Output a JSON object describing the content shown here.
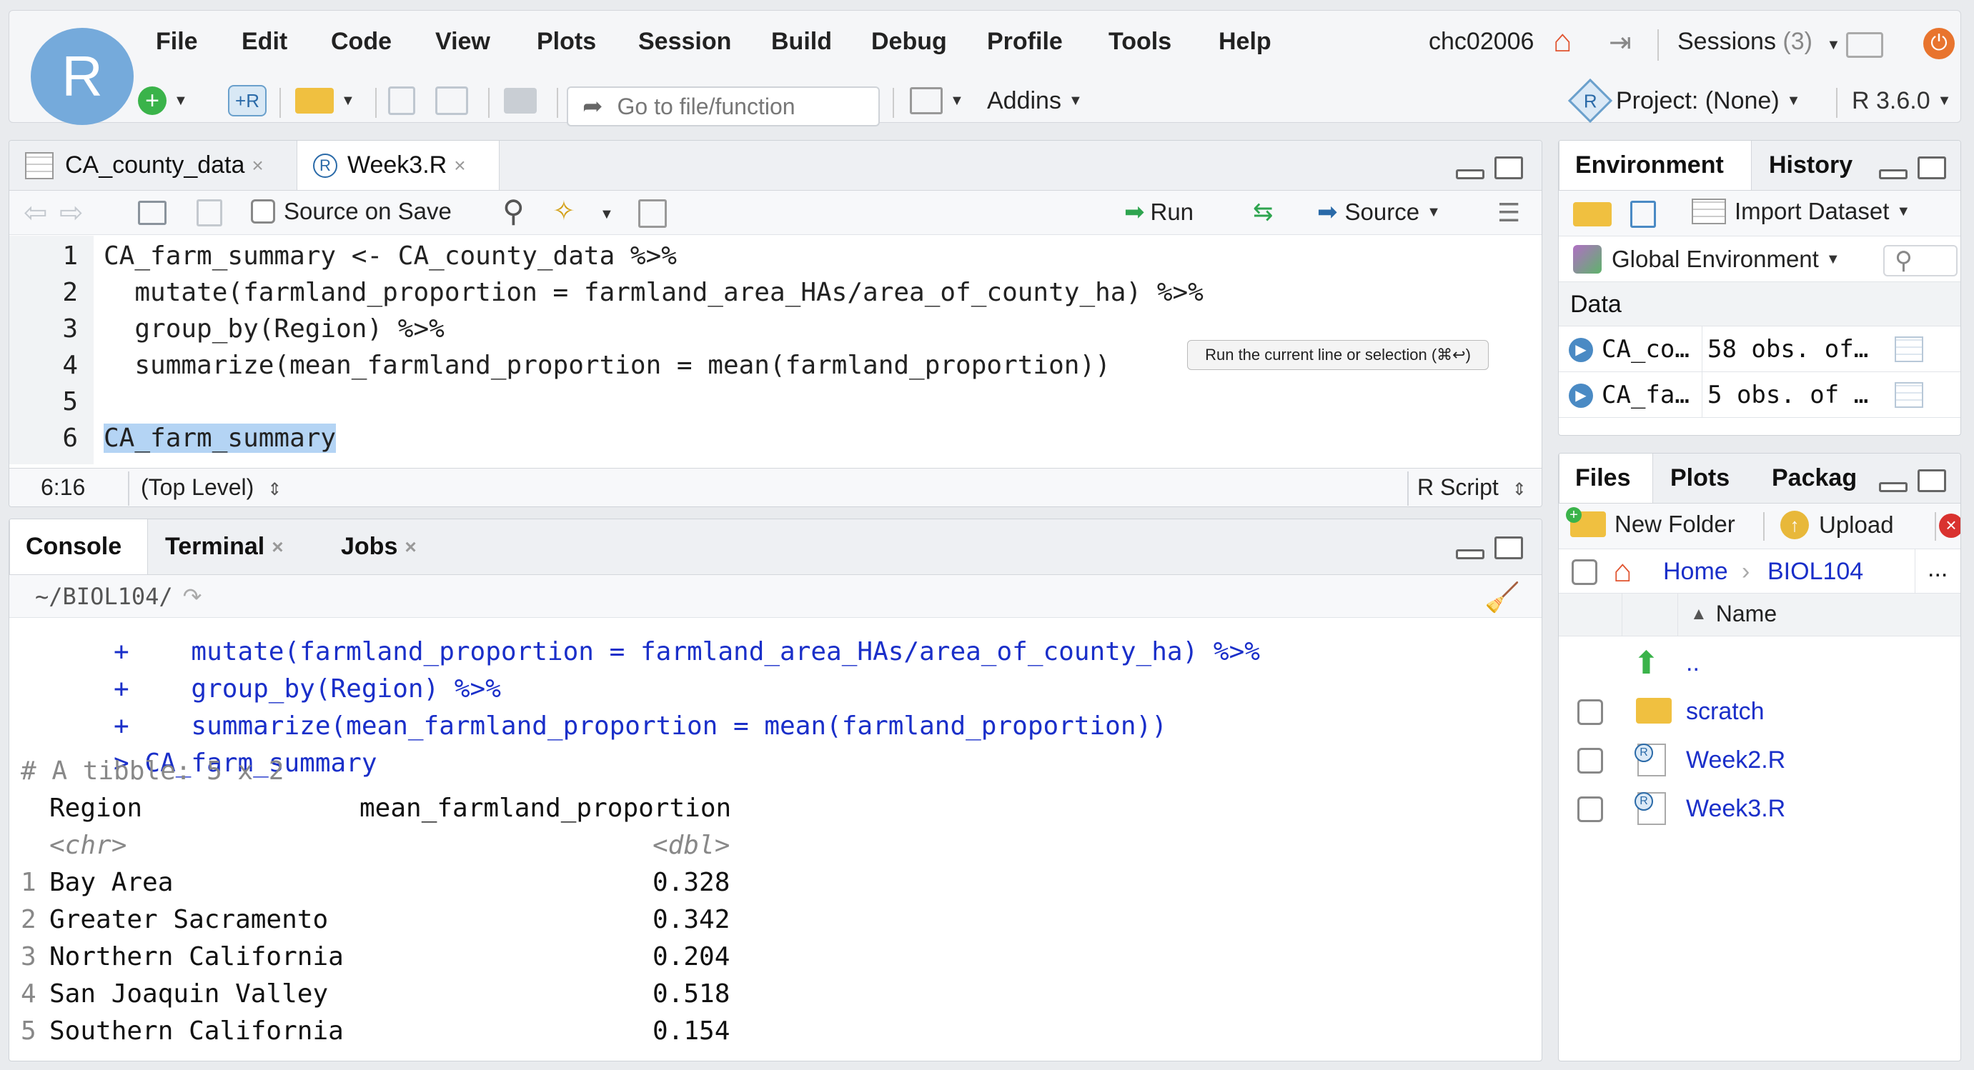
{
  "menu": {
    "items": [
      "File",
      "Edit",
      "Code",
      "View",
      "Plots",
      "Session",
      "Build",
      "Debug",
      "Profile",
      "Tools",
      "Help"
    ],
    "user": "chc02006",
    "sessions_label": "Sessions",
    "sessions_count": "(3)"
  },
  "toolbar": {
    "goto_placeholder": "Go to file/function",
    "addins_label": "Addins",
    "project_label": "Project: (None)",
    "r_version": "R 3.6.0"
  },
  "editor": {
    "tabs": [
      {
        "label": "CA_county_data",
        "active": false
      },
      {
        "label": "Week3.R",
        "active": true
      }
    ],
    "source_on_save": "Source on Save",
    "run_label": "Run",
    "source_label": "Source",
    "tooltip": "Run the current line or selection (⌘↩)",
    "lines": [
      "CA_farm_summary <- CA_county_data %>%",
      "  mutate(farmland_proportion = farmland_area_HAs/area_of_county_ha) %>%",
      "  group_by(Region) %>%",
      "  summarize(mean_farmland_proportion = mean(farmland_proportion))",
      "",
      "CA_farm_summary"
    ],
    "line_numbers": [
      "1",
      "2",
      "3",
      "4",
      "5",
      "6"
    ],
    "cursor_pos": "6:16",
    "scope": "(Top Level)",
    "file_type": "R Script"
  },
  "console": {
    "tabs": [
      {
        "label": "Console",
        "active": true
      },
      {
        "label": "Terminal",
        "active": false
      },
      {
        "label": "Jobs",
        "active": false
      }
    ],
    "path": "~/BIOL104/",
    "lines": [
      {
        "prefix": "+",
        "text": "    mutate(farmland_proportion = farmland_area_HAs/area_of_county_ha) %>%"
      },
      {
        "prefix": "+",
        "text": "    group_by(Region) %>%"
      },
      {
        "prefix": "+",
        "text": "    summarize(mean_farmland_proportion = mean(farmland_proportion))"
      },
      {
        "prefix": ">",
        "text": " CA_farm_summary"
      }
    ],
    "tibble_header": "# A tibble: 5 x 2",
    "columns": [
      "Region",
      "mean_farmland_proportion"
    ],
    "types": [
      "<chr>",
      "<dbl>"
    ],
    "rows": [
      {
        "n": "1",
        "region": "Bay Area",
        "value": "0.328"
      },
      {
        "n": "2",
        "region": "Greater Sacramento",
        "value": "0.342"
      },
      {
        "n": "3",
        "region": "Northern California",
        "value": "0.204"
      },
      {
        "n": "4",
        "region": "San Joaquin Valley",
        "value": "0.518"
      },
      {
        "n": "5",
        "region": "Southern California",
        "value": "0.154"
      }
    ]
  },
  "environment": {
    "tabs": [
      "Environment",
      "History"
    ],
    "import_label": "Import Dataset",
    "global_env": "Global Environment",
    "section": "Data",
    "items": [
      {
        "name": "CA_co…",
        "desc": "58 obs. of…"
      },
      {
        "name": "CA_fa…",
        "desc": "5 obs. of …"
      }
    ]
  },
  "files": {
    "tabs": [
      "Files",
      "Plots",
      "Packag"
    ],
    "new_folder": "New Folder",
    "upload": "Upload",
    "breadcrumb_home": "Home",
    "breadcrumb_dir": "BIOL104",
    "more": "...",
    "name_header": "Name",
    "up": "..",
    "entries": [
      {
        "name": "scratch",
        "type": "folder"
      },
      {
        "name": "Week2.R",
        "type": "rfile"
      },
      {
        "name": "Week3.R",
        "type": "rfile"
      }
    ]
  }
}
